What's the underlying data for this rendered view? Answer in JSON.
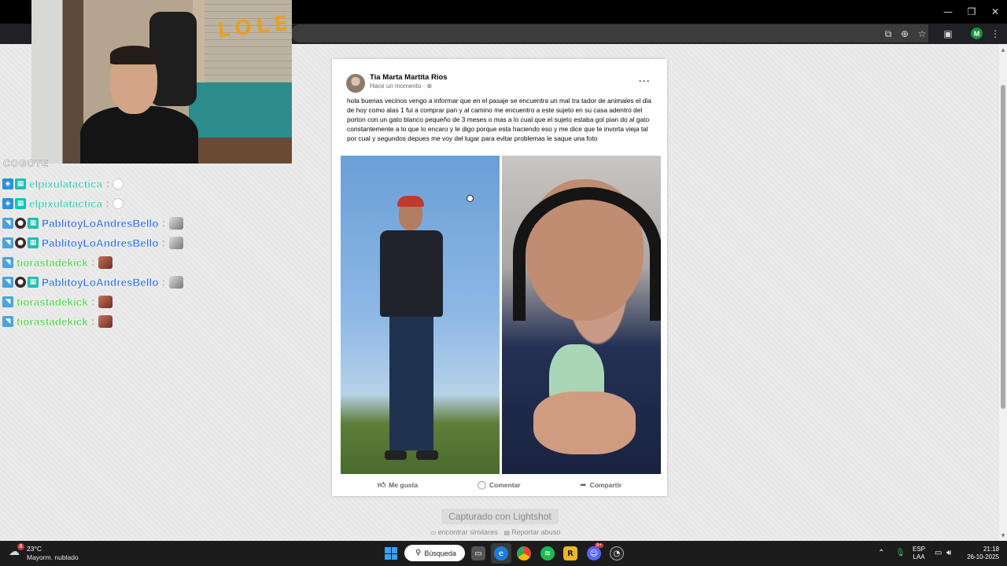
{
  "window": {
    "controls": {
      "minimize": "—",
      "restore": "❐",
      "close": "✕"
    }
  },
  "toolbar": {
    "profile_initial": "M",
    "icons": [
      "install-icon",
      "zoom-icon",
      "star-icon",
      "extensions-icon",
      "profile-avatar",
      "menu-icon"
    ]
  },
  "post": {
    "author": "Tia Marta Martita Rios",
    "timestamp": "Hace un momento",
    "privacy_glyph": "·",
    "more_glyph": "···",
    "text": "hola buenas vecinos vengo a informar que en el pasaje se encuentra un mal tra tador de animales el dia de hoy como alas 1 fui a comprar pan y al camino me encuentro a este sujeto en su casa adentro del porton con un gato blanco pequeño de 3 meses o mas a lo cual que el sujeto estaba gol pian do al gato constantemente a lo que lo encaro y le digo porque esta haciendo eso y me dice que te invorta vieja tal por cual y segundos depues me voy del lugar para evitar problemas le saque una foto",
    "actions": {
      "like": "Me gusta",
      "comment": "Comentar",
      "share": "Compartir"
    }
  },
  "lightshot": {
    "captured": "Capturado con Lightshot",
    "similar": "encontrar similares",
    "report": "Reportar abuso"
  },
  "stream": {
    "banner": "LOLEN",
    "chat_title": "COGOTE",
    "chat": [
      {
        "user": "elpixulatactica",
        "color": "#3ec9a9",
        "badges": [
          "blue",
          "teal"
        ],
        "emote": "small"
      },
      {
        "user": "elpixulatactica",
        "color": "#3ec9a9",
        "badges": [
          "blue",
          "teal"
        ],
        "emote": "small"
      },
      {
        "user": "PablitoyLoAndresBello",
        "color": "#2f6fd8",
        "badges": [
          "sky",
          "dark",
          "teal"
        ],
        "emote": "grey"
      },
      {
        "user": "PablitoyLoAndresBello",
        "color": "#2f6fd8",
        "badges": [
          "sky",
          "dark",
          "teal"
        ],
        "emote": "grey"
      },
      {
        "user": "tiorastadekick",
        "color": "#4fd14a",
        "badges": [
          "sky"
        ],
        "emote": "red"
      },
      {
        "user": "PablitoyLoAndresBello",
        "color": "#2f6fd8",
        "badges": [
          "sky",
          "dark",
          "teal"
        ],
        "emote": "grey"
      },
      {
        "user": "tiorastadekick",
        "color": "#4fd14a",
        "badges": [
          "sky"
        ],
        "emote": "red"
      },
      {
        "user": "tiorastadekick",
        "color": "#4fd14a",
        "badges": [
          "sky"
        ],
        "emote": "red"
      }
    ]
  },
  "taskbar": {
    "weather_badge": "8",
    "temperature": "23°C",
    "weather": "Mayorm. nublado",
    "search": "Búsqueda",
    "discord_badge": "9+",
    "lang_top": "ESP",
    "lang_bottom": "LAA",
    "time": "21:18",
    "date": "26-10-2025"
  }
}
